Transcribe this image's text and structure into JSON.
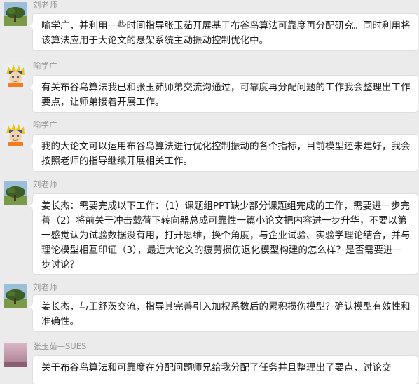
{
  "messages": [
    {
      "sender": "刘老师",
      "avatar_icon": "tree-landscape-avatar-icon",
      "text": "喻学广，并利用一些时间指导张玉茹开展基于布谷鸟算法可靠度再分配研究。同时利用将该算法应用于大论文的悬架系统主动振动控制优化中。"
    },
    {
      "sender": "喻学广",
      "avatar_icon": "naruto-avatar-icon",
      "text": "有关布谷鸟算法我已和张玉茹师弟交流沟通过，可靠度再分配问题的工作我会整理出工作要点，让师弟接着开展工作。"
    },
    {
      "sender": "喻学广",
      "avatar_icon": "naruto-avatar-icon",
      "text": "我的大论文可以运用布谷鸟算法进行优化控制振动的各个指标，目前模型还未建好，我会按照老师的指导继续开展相关工作。"
    },
    {
      "sender": "刘老师",
      "avatar_icon": "tree-landscape-avatar-icon",
      "text": "姜长杰：需要完成以下工作：（1）课题组PPT缺少部分课题组完成的工作，需要进一步完善（2）将前关于冲击载荷下转向器总成可靠性一篇小论文把内容进一步升华，不要以第一感觉认为试验数据没有用，打开思维，换个角度，与企业试验、实验学理论结合，并与理论模型相互印证（3），最近大论文的疲劳损伤退化模型构建的怎么样？是否需要进一步讨论？"
    },
    {
      "sender": "刘老师",
      "avatar_icon": "tree-landscape-avatar-icon",
      "text": "姜长杰，与王舒茨交流，指导其完善引入加权系数后的累积损伤模型？确认模型有效性和准确性。"
    },
    {
      "sender": "张玉茹—SUES",
      "avatar_icon": "pink-sky-avatar-icon",
      "text": "关于布谷鸟算法和可靠度在分配问题师兄给我分配了任务并且整理出了要点，讨论交"
    }
  ]
}
